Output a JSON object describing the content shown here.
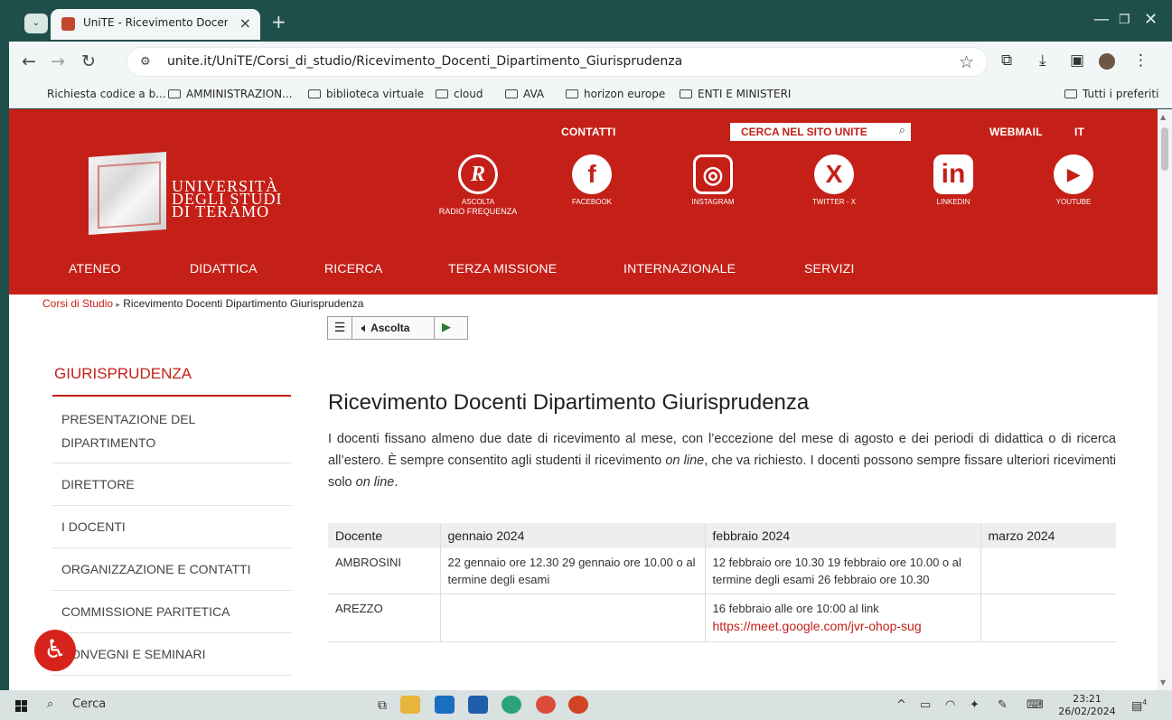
{
  "browser": {
    "tab_title": "UniTE - Ricevimento Docenti Di",
    "tab_close": "×",
    "new_tab": "+",
    "url": "unite.it/UniTE/Corsi_di_studio/Ricevimento_Docenti_Dipartimento_Giurisprudenza",
    "bookmarks": [
      "Richiesta codice a b...",
      "AMMINISTRAZION...",
      "biblioteca virtuale",
      "cloud",
      "AVA",
      "horizon europe",
      "ENTI E MINISTERI"
    ],
    "all_bookmarks": "Tutti i preferiti"
  },
  "header": {
    "contatti": "CONTATTI",
    "search_placeholder": "CERCA NEL SITO UNITE",
    "webmail": "WEBMAIL",
    "lang": "IT",
    "logo_lines": [
      "UNIVERSITÀ",
      "DEGLI STUDI",
      "DI TERAMO"
    ],
    "social": [
      {
        "icon": "radio-frequenza-icon",
        "glyph": "R",
        "label_lines": [
          "ASCOLTA",
          "RADIO FREQUENZA"
        ]
      },
      {
        "icon": "facebook-icon",
        "glyph": "f",
        "label_lines": [
          "FACEBOOK"
        ]
      },
      {
        "icon": "instagram-icon",
        "glyph": "◎",
        "label_lines": [
          "INSTAGRAM"
        ]
      },
      {
        "icon": "twitter-x-icon",
        "glyph": "X",
        "label_lines": [
          "TWITTER - X"
        ]
      },
      {
        "icon": "linkedin-icon",
        "glyph": "in",
        "label_lines": [
          "LINKEDIN"
        ]
      },
      {
        "icon": "youtube-icon",
        "glyph": "▶",
        "label_lines": [
          "YOUTUBE"
        ]
      }
    ],
    "nav": [
      "ATENEO",
      "DIDATTICA",
      "RICERCA",
      "TERZA MISSIONE",
      "INTERNAZIONALE",
      "SERVIZI"
    ]
  },
  "breadcrumb": {
    "parent": "Corsi di Studio",
    "separator": "▸",
    "current": "Ricevimento Docenti Dipartimento Giurisprudenza"
  },
  "reader": {
    "listen": "Ascolta"
  },
  "sidebar": {
    "title": "GIURISPRUDENZA",
    "items": [
      "PRESENTAZIONE DEL DIPARTIMENTO",
      "DIRETTORE",
      "I DOCENTI",
      "ORGANIZZAZIONE E CONTATTI",
      "COMMISSIONE PARITETICA",
      "CONVEGNI E SEMINARI"
    ]
  },
  "content": {
    "title": "Ricevimento Docenti Dipartimento Giurisprudenza",
    "intro_1": "I docenti fissano almeno due date di ricevimento al mese, con l’eccezione del mese di agosto e dei periodi di didattica o di ricerca all’estero. È sempre consentito agli studenti il ricevimento ",
    "intro_em_1": "on line",
    "intro_2": ", che va richiesto. I docenti possono sempre fissare ulteriori ricevimenti solo ",
    "intro_em_2": "on line",
    "intro_3": ".",
    "table": {
      "headers": [
        "Docente",
        "gennaio 2024",
        "febbraio 2024",
        "marzo 2024"
      ],
      "rows": [
        {
          "docente": "AMBROSINI",
          "gennaio": "22 gennaio ore 12.30 29 gennaio ore 10.00 o al termine degli esami",
          "febbraio": "12 febbraio ore 10.30 19 febbraio ore 10.00 o al termine degli esami 26 febbraio ore 10.30",
          "marzo": ""
        },
        {
          "docente": "AREZZO",
          "gennaio": "",
          "febbraio_text": "16 febbraio alle ore 10:00 al link",
          "febbraio_link": "https://meet.google.com/jvr-ohop-sug",
          "marzo": ""
        }
      ]
    }
  },
  "taskbar": {
    "search": "Cerca",
    "time": "23:21",
    "date": "26/02/2024",
    "notifications": "4"
  }
}
